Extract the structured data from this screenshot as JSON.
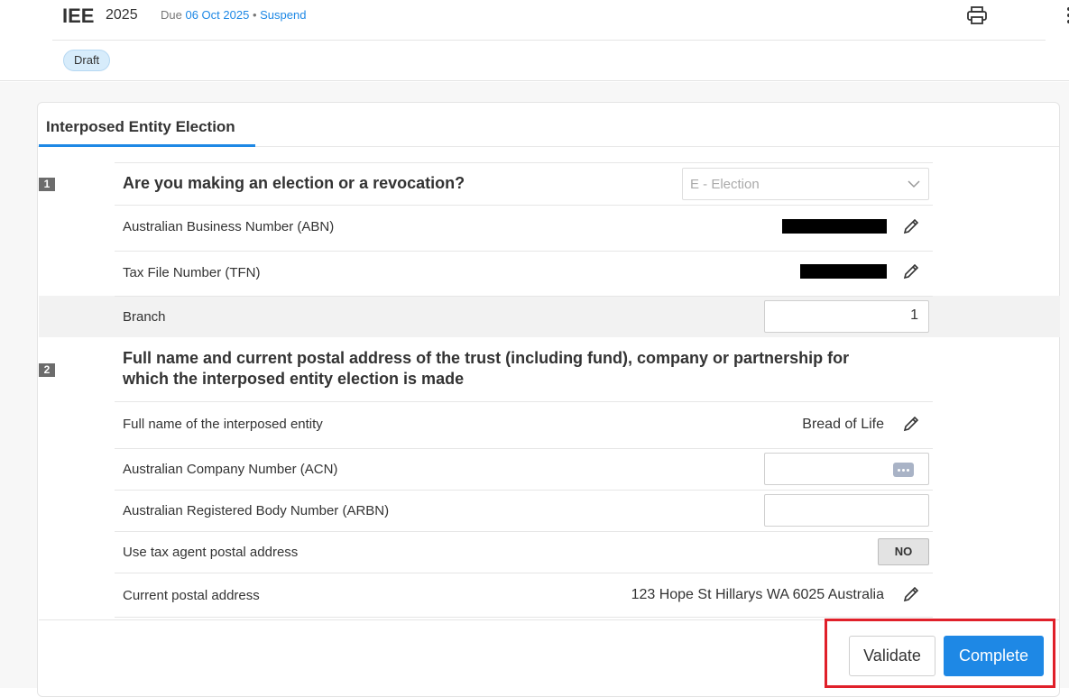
{
  "header": {
    "form_code": "IEE",
    "year": "2025",
    "due_prefix": "Due",
    "due_date": "06 Oct 2025",
    "separator": "•",
    "suspend_label": "Suspend",
    "print_icon": "printer-icon",
    "more_icon": "more-vertical-icon"
  },
  "status_badge": "Draft",
  "tab": {
    "label": "Interposed Entity Election"
  },
  "section1": {
    "number": "1",
    "question": "Are you making an election or a revocation?",
    "select_value": "E - Election",
    "abn_label": "Australian Business Number (ABN)",
    "tfn_label": "Tax File Number (TFN)",
    "branch_label": "Branch",
    "branch_value": "1"
  },
  "section2": {
    "number": "2",
    "question_line1": "Full name and current postal address of the trust (including fund), company or partnership for",
    "question_line2": "which the interposed entity election is made",
    "entity_name_label": "Full name of the interposed entity",
    "entity_name_value": "Bread of Life",
    "acn_label": "Australian Company Number (ACN)",
    "acn_value": "",
    "arbn_label": "Australian Registered Body Number (ARBN)",
    "arbn_value": "",
    "tax_agent_label": "Use tax agent postal address",
    "tax_agent_value": "NO",
    "postal_label": "Current postal address",
    "postal_value": "123 Hope St Hillarys WA 6025 Australia"
  },
  "footer": {
    "validate_label": "Validate",
    "complete_label": "Complete"
  },
  "colors": {
    "accent": "#1e88e5",
    "highlight": "#e0202a",
    "badge_bg": "#d7ecfb"
  }
}
